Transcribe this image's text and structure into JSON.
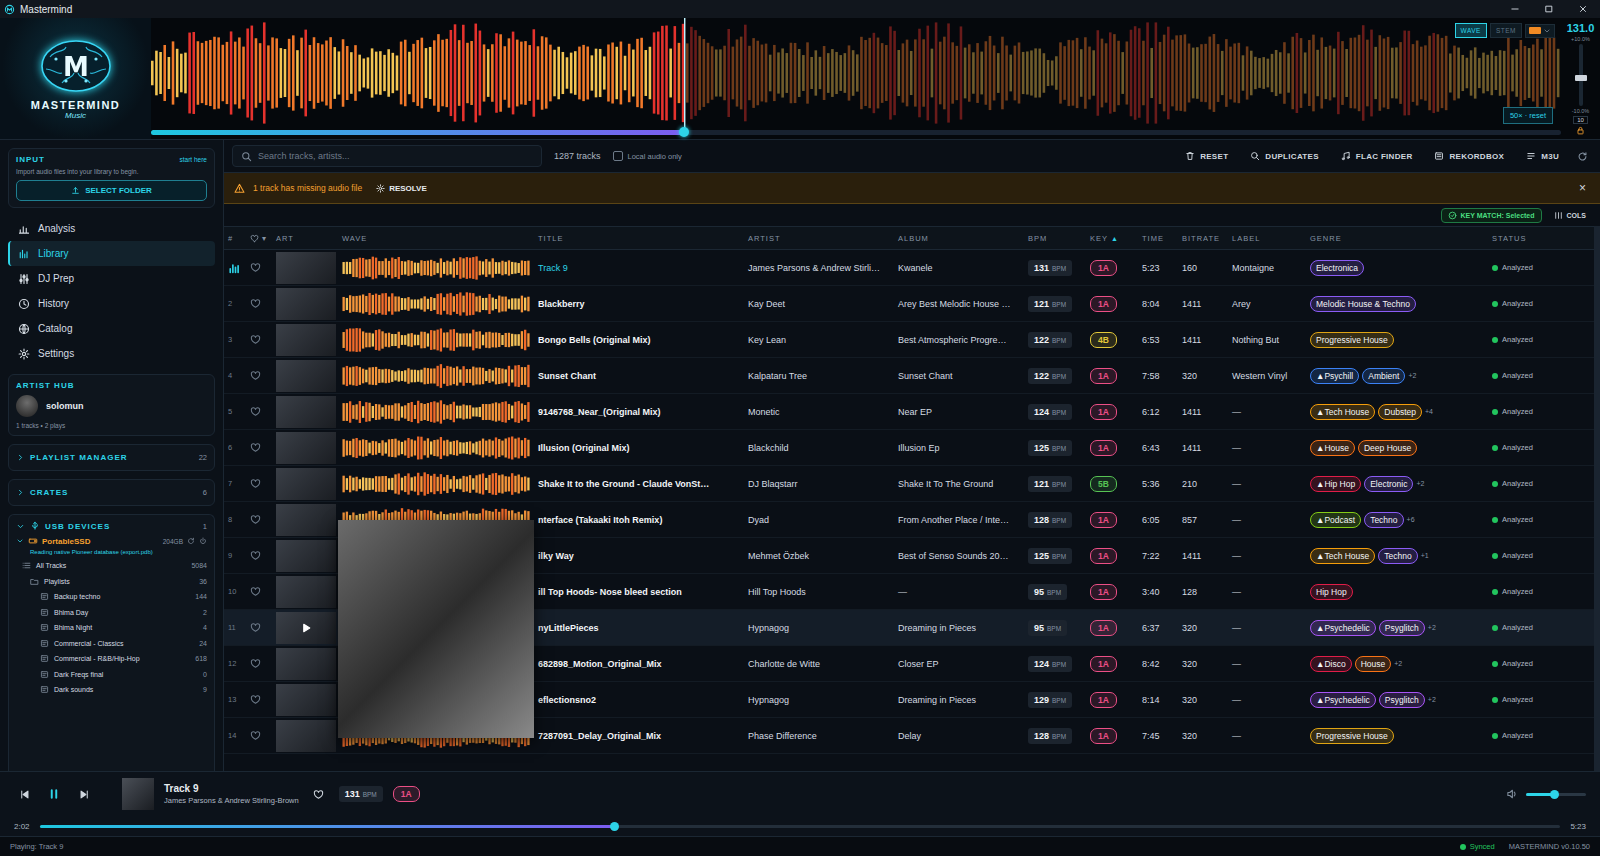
{
  "window": {
    "title": "Mastermind"
  },
  "logo": {
    "mark": "M",
    "name": "MASTERMIND",
    "sub": "Music"
  },
  "deck": {
    "modes": [
      {
        "label": "WAVE",
        "selected": true
      },
      {
        "label": "STEM",
        "selected": false
      }
    ],
    "swatch_color": "#f08a24",
    "bpm": "131.0",
    "pitch": {
      "top": "+10.0%",
      "bottom": "-10.0%",
      "range": "10",
      "level": 0.45
    },
    "zoom_button": "50× · reset",
    "position": 0.378
  },
  "sidebar": {
    "input": {
      "title": "INPUT",
      "hint": "start here",
      "text": "Import audio files into your library to begin.",
      "button": "SELECT FOLDER"
    },
    "nav": [
      {
        "label": "Analysis",
        "selected": false
      },
      {
        "label": "Library",
        "selected": true
      },
      {
        "label": "DJ Prep",
        "selected": false
      },
      {
        "label": "History",
        "selected": false
      },
      {
        "label": "Catalog",
        "selected": false
      },
      {
        "label": "Settings",
        "selected": false
      }
    ],
    "artist_hub": {
      "title": "ARTIST HUB",
      "artist": "solomun",
      "stats": "1 tracks • 2 plays"
    },
    "panels": [
      {
        "title": "PLAYLIST MANAGER",
        "count": "22",
        "expanded": false
      },
      {
        "title": "CRATES",
        "count": "6",
        "expanded": false
      }
    ],
    "usb": {
      "title": "USB DEVICES",
      "count": "1",
      "expanded": true,
      "device": {
        "name": "PortableSSD",
        "size": "204GB",
        "status": "Reading native Pioneer database (export.pdb)",
        "expanded": true
      },
      "items": [
        {
          "label": "All Tracks",
          "count": "5084",
          "kind": "list"
        },
        {
          "label": "Playlists",
          "count": "36",
          "kind": "folder"
        },
        {
          "label": "Backup techno",
          "count": "144",
          "kind": "playlist"
        },
        {
          "label": "Bhima Day",
          "count": "2",
          "kind": "playlist"
        },
        {
          "label": "Bhima Night",
          "count": "4",
          "kind": "playlist"
        },
        {
          "label": "Commercial - Classics",
          "count": "24",
          "kind": "playlist"
        },
        {
          "label": "Commercial - R&B/Hip-Hop",
          "count": "618",
          "kind": "playlist"
        },
        {
          "label": "Dark Freqs final",
          "count": "0",
          "kind": "playlist"
        },
        {
          "label": "Dark sounds",
          "count": "9",
          "kind": "playlist"
        }
      ]
    }
  },
  "toolbar": {
    "search_placeholder": "Search tracks, artists...",
    "count": "1287 tracks",
    "local_only": {
      "label": "Local audio only",
      "checked": false
    },
    "buttons": [
      "RESET",
      "DUPLICATES",
      "FLAC FINDER",
      "REKORDBOX",
      "M3U"
    ]
  },
  "warning": {
    "text": "1 track has missing audio file",
    "action": "RESOLVE",
    "close": "×"
  },
  "table_tools": {
    "key_match": "KEY MATCH: Selected",
    "cols": "COLS"
  },
  "table": {
    "bpm_unit": "BPM",
    "columns": [
      {
        "label": "#",
        "kind": "text"
      },
      {
        "label": "▾",
        "kind": "like"
      },
      {
        "label": "ART",
        "kind": "text"
      },
      {
        "label": "WAVE",
        "kind": "text"
      },
      {
        "label": "TITLE",
        "kind": "text"
      },
      {
        "label": "ARTIST",
        "kind": "text"
      },
      {
        "label": "ALBUM",
        "kind": "text"
      },
      {
        "label": "BPM",
        "kind": "text"
      },
      {
        "label": "KEY",
        "kind": "text",
        "sort": "▲"
      },
      {
        "label": "TIME",
        "kind": "text"
      },
      {
        "label": "BITRATE",
        "kind": "text"
      },
      {
        "label": "LABEL",
        "kind": "text"
      },
      {
        "label": "GENRE",
        "kind": "text"
      },
      {
        "label": "STATUS",
        "kind": "text"
      }
    ],
    "rows": [
      {
        "playing": true,
        "hovered": false,
        "liked": false,
        "title": "Track 9",
        "artist": "James Parsons & Andrew Stirli…",
        "album": "Kwanele",
        "bpm": "131",
        "key": {
          "label": "1A",
          "color": "#ec4f86"
        },
        "time": "5:23",
        "bitrate": "160",
        "label": "Montaigne",
        "genres": [
          {
            "label": "Electronica",
            "color": "#8b5cf6"
          }
        ],
        "status": {
          "label": "Analyzed",
          "color": "#22c55e"
        }
      },
      {
        "num": "2",
        "playing": false,
        "hovered": false,
        "liked": false,
        "title": "Blackberry",
        "artist": "Kay Deet",
        "album": "Arey Best Melodic House …",
        "bpm": "121",
        "key": {
          "label": "1A",
          "color": "#ec4f86"
        },
        "time": "8:04",
        "bitrate": "1411",
        "label": "Arey",
        "genres": [
          {
            "label": "Melodic House & Techno",
            "color": "#8b5cf6"
          }
        ],
        "status": {
          "label": "Analyzed",
          "color": "#22c55e"
        }
      },
      {
        "num": "3",
        "playing": false,
        "hovered": false,
        "liked": false,
        "title": "Bongo Bells (Original Mix)",
        "artist": "Key Lean",
        "album": "Best Atmospheric Progre…",
        "bpm": "122",
        "key": {
          "label": "4B",
          "color": "#e3c93a"
        },
        "time": "6:53",
        "bitrate": "1411",
        "label": "Nothing But",
        "genres": [
          {
            "label": "Progressive House",
            "color": "#e0a514"
          }
        ],
        "status": {
          "label": "Analyzed",
          "color": "#22c55e"
        }
      },
      {
        "num": "4",
        "playing": false,
        "hovered": false,
        "liked": false,
        "title": "Sunset Chant",
        "artist": "Kalpataru Tree",
        "album": "Sunset Chant",
        "bpm": "122",
        "key": {
          "label": "1A",
          "color": "#ec4f86"
        },
        "time": "7:58",
        "bitrate": "320",
        "label": "Western Vinyl",
        "genres": [
          {
            "label": "▲Psychill",
            "color": "#3b82f6"
          },
          {
            "label": "Ambient",
            "color": "#3b82f6"
          }
        ],
        "more": "+2",
        "status": {
          "label": "Analyzed",
          "color": "#22c55e"
        }
      },
      {
        "num": "5",
        "playing": false,
        "hovered": false,
        "liked": false,
        "title": "9146768_Near_(Original Mix)",
        "artist": "Monetic",
        "album": "Near EP",
        "bpm": "124",
        "key": {
          "label": "1A",
          "color": "#ec4f86"
        },
        "time": "6:12",
        "bitrate": "1411",
        "label": "—",
        "genres": [
          {
            "label": "▲Tech House",
            "color": "#f59e0b"
          },
          {
            "label": "Dubstep",
            "color": "#f59e0b"
          }
        ],
        "more": "+4",
        "status": {
          "label": "Analyzed",
          "color": "#22c55e"
        }
      },
      {
        "num": "6",
        "playing": false,
        "hovered": false,
        "liked": false,
        "title": "Illusion (Original Mix)",
        "artist": "Blackchild",
        "album": "Illusion Ep",
        "bpm": "125",
        "key": {
          "label": "1A",
          "color": "#ec4f86"
        },
        "time": "6:43",
        "bitrate": "1411",
        "label": "—",
        "genres": [
          {
            "label": "▲House",
            "color": "#f97316"
          },
          {
            "label": "Deep House",
            "color": "#f97316"
          }
        ],
        "status": {
          "label": "Analyzed",
          "color": "#22c55e"
        }
      },
      {
        "num": "7",
        "playing": false,
        "hovered": false,
        "liked": false,
        "title": "Shake It to the Ground - Claude VonSt…",
        "artist": "DJ Blaqstarr",
        "album": "Shake It To The Ground",
        "bpm": "121",
        "key": {
          "label": "5B",
          "color": "#57c454"
        },
        "time": "5:36",
        "bitrate": "210",
        "label": "—",
        "genres": [
          {
            "label": "▲Hip Hop",
            "color": "#e11d48"
          },
          {
            "label": "Electronic",
            "color": "#8b5cf6"
          }
        ],
        "more": "+2",
        "status": {
          "label": "Analyzed",
          "color": "#22c55e"
        }
      },
      {
        "num": "8",
        "playing": false,
        "hovered": false,
        "liked": false,
        "title": "nterface (Takaaki Itoh Remix)",
        "artist": "Dyad",
        "album": "From Another Place / Inte…",
        "bpm": "128",
        "key": {
          "label": "1A",
          "color": "#ec4f86"
        },
        "time": "6:05",
        "bitrate": "857",
        "label": "—",
        "genres": [
          {
            "label": "▲Podcast",
            "color": "#84cc16"
          },
          {
            "label": "Techno",
            "color": "#8b5cf6"
          }
        ],
        "more": "+6",
        "status": {
          "label": "Analyzed",
          "color": "#22c55e"
        }
      },
      {
        "num": "9",
        "playing": false,
        "hovered": false,
        "liked": false,
        "title": "ilky Way",
        "artist": "Mehmet Özbek",
        "album": "Best of Senso Sounds 20…",
        "bpm": "125",
        "key": {
          "label": "1A",
          "color": "#ec4f86"
        },
        "time": "7:22",
        "bitrate": "1411",
        "label": "—",
        "genres": [
          {
            "label": "▲Tech House",
            "color": "#f59e0b"
          },
          {
            "label": "Techno",
            "color": "#8b5cf6"
          }
        ],
        "more": "+1",
        "status": {
          "label": "Analyzed",
          "color": "#22c55e"
        }
      },
      {
        "num": "10",
        "playing": false,
        "hovered": false,
        "liked": false,
        "title": "ill Top Hoods- Nose bleed section",
        "artist": "Hill Top Hoods",
        "album": "—",
        "bpm": "95",
        "key": {
          "label": "1A",
          "color": "#ec4f86"
        },
        "time": "3:40",
        "bitrate": "128",
        "label": "—",
        "genres": [
          {
            "label": "Hip Hop",
            "color": "#e11d48"
          }
        ],
        "status": {
          "label": "Analyzed",
          "color": "#22c55e"
        }
      },
      {
        "num": "11",
        "playing": false,
        "hovered": true,
        "liked": false,
        "title": "nyLittlePieces",
        "artist": "Hypnagog",
        "album": "Dreaming in Pieces",
        "bpm": "95",
        "key": {
          "label": "1A",
          "color": "#ec4f86"
        },
        "time": "6:37",
        "bitrate": "320",
        "label": "—",
        "genres": [
          {
            "label": "▲Psychedelic",
            "color": "#a855f7"
          },
          {
            "label": "Psyglitch",
            "color": "#a855f7"
          }
        ],
        "more": "+2",
        "status": {
          "label": "Analyzed",
          "color": "#22c55e"
        }
      },
      {
        "num": "12",
        "playing": false,
        "hovered": false,
        "liked": false,
        "title": "682898_Motion_Original_Mix",
        "artist": "Charlotte de Witte",
        "album": "Closer EP",
        "bpm": "124",
        "key": {
          "label": "1A",
          "color": "#ec4f86"
        },
        "time": "8:42",
        "bitrate": "320",
        "label": "—",
        "genres": [
          {
            "label": "▲Disco",
            "color": "#e11d48"
          },
          {
            "label": "House",
            "color": "#f97316"
          }
        ],
        "more": "+2",
        "status": {
          "label": "Analyzed",
          "color": "#22c55e"
        }
      },
      {
        "num": "13",
        "playing": false,
        "hovered": false,
        "liked": false,
        "title": "eflectionsno2",
        "artist": "Hypnagog",
        "album": "Dreaming in Pieces",
        "bpm": "129",
        "key": {
          "label": "1A",
          "color": "#ec4f86"
        },
        "time": "8:14",
        "bitrate": "320",
        "label": "—",
        "genres": [
          {
            "label": "▲Psychedelic",
            "color": "#a855f7"
          },
          {
            "label": "Psyglitch",
            "color": "#a855f7"
          }
        ],
        "more": "+2",
        "status": {
          "label": "Analyzed",
          "color": "#22c55e"
        }
      },
      {
        "num": "14",
        "playing": false,
        "hovered": false,
        "liked": false,
        "title": "7287091_Delay_Original_Mix",
        "artist": "Phase Difference",
        "album": "Delay",
        "bpm": "128",
        "key": {
          "label": "1A",
          "color": "#ec4f86"
        },
        "time": "7:45",
        "bitrate": "320",
        "label": "—",
        "genres": [
          {
            "label": "Progressive House",
            "color": "#e0a514"
          }
        ],
        "status": {
          "label": "Analyzed",
          "color": "#22c55e"
        }
      }
    ]
  },
  "art_preview": {
    "open": true
  },
  "player": {
    "title": "Track 9",
    "artist": "James Parsons & Andrew Stirling-Brown",
    "bpm": "131",
    "bpm_unit": "BPM",
    "key": {
      "label": "1A",
      "color": "#ec4f86"
    },
    "elapsed": "2:02",
    "total": "5:23",
    "level": 0.378,
    "playing": true,
    "liked": false,
    "volume": 0.47
  },
  "status_bar": {
    "text": "Playing: Track 9",
    "sync": {
      "label": "Synced",
      "color": "#22c55e"
    },
    "version": "MASTERMIND v0.10.50"
  }
}
